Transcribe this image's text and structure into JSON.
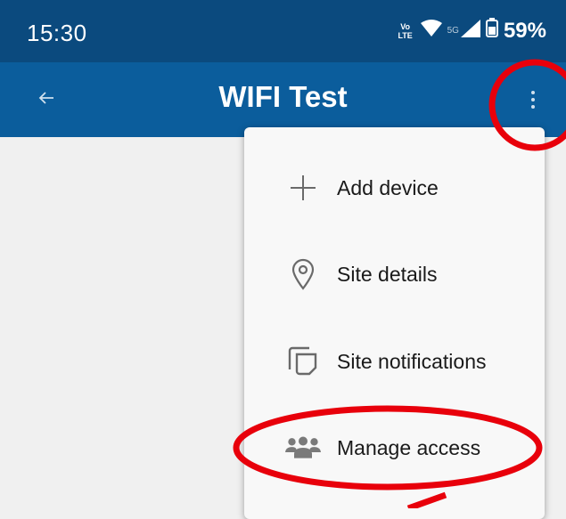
{
  "status_bar": {
    "time": "15:30",
    "volte_top": "Vo",
    "volte_bottom": "LTE",
    "network_label": "5G",
    "battery_percent": "59%"
  },
  "app_bar": {
    "title": "WIFI Test",
    "back_icon": "back-arrow-icon",
    "more_icon": "more-vertical-icon"
  },
  "menu": {
    "items": [
      {
        "label": "Add device",
        "icon": "plus-icon"
      },
      {
        "label": "Site details",
        "icon": "location-pin-icon"
      },
      {
        "label": "Site notifications",
        "icon": "copy-notifications-icon"
      },
      {
        "label": "Manage access",
        "icon": "people-group-icon"
      }
    ]
  },
  "colors": {
    "status_bar_bg": "#0b4a7e",
    "app_bar_bg": "#0b5d9c",
    "menu_bg": "#f8f8f8",
    "annotation_red": "#e8000b",
    "page_bg": "#f0f0f0"
  }
}
